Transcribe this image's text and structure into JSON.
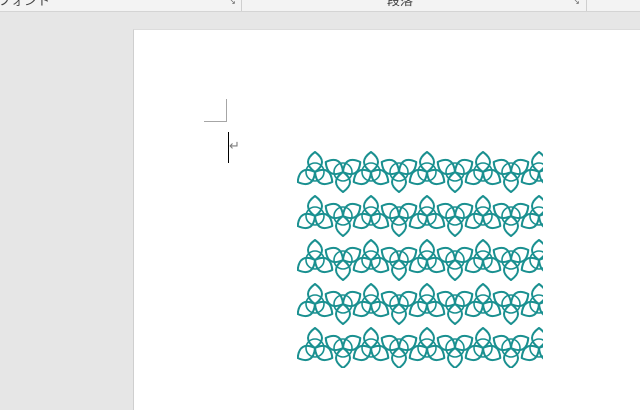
{
  "ribbon": {
    "font_group_label": "フォント",
    "paragraph_group_label": "段落",
    "launcher_glyph": "↘"
  },
  "document": {
    "paragraph_mark": "↵",
    "pattern": {
      "name": "celtic-triquetra-tessellation",
      "color": "#1a9090",
      "rows": 5,
      "cols": 9
    }
  },
  "colors": {
    "app_background": "#e6e6e6",
    "page": "#ffffff",
    "pattern_stroke": "#1a9090"
  }
}
